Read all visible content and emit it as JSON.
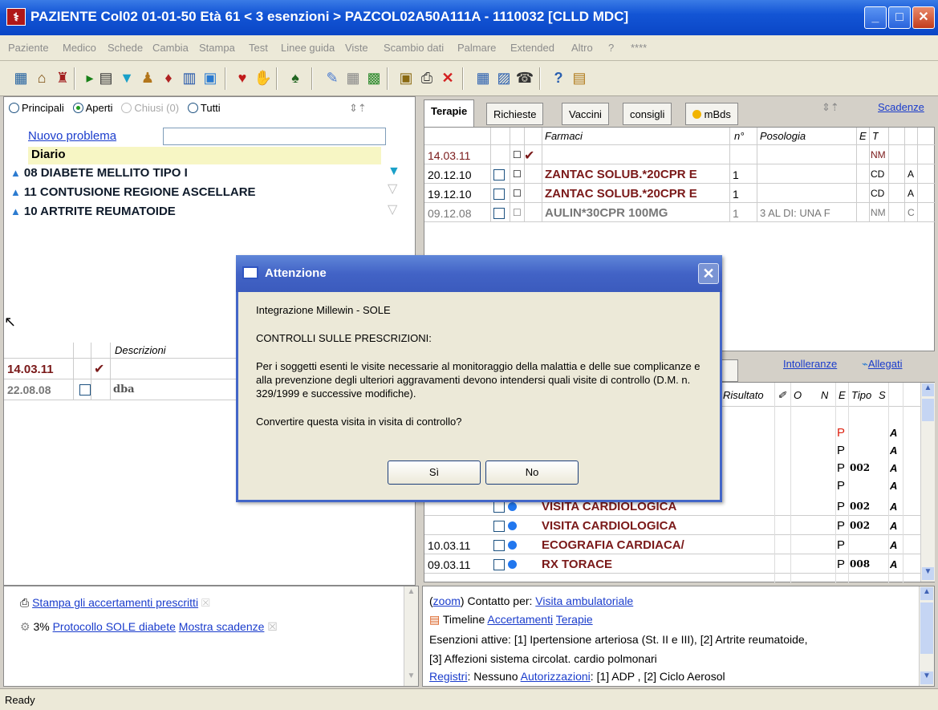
{
  "window": {
    "title": "PAZIENTE Col02  01-01-50  Età 61  < 3 esenzioni >  PAZCOL02A50A111A - 1110032  [CLLD MDC]",
    "icon": "app-icon",
    "min": "_",
    "max": "□",
    "close": "✕"
  },
  "menu": [
    "Paziente",
    "Medico",
    "Schede",
    "Cambia",
    "Stampa",
    "Test",
    "Linee guida",
    "Viste",
    "Scambio dati",
    "Palmare",
    "Extended",
    "Altro",
    "?",
    "****"
  ],
  "left": {
    "filters": {
      "principali": "Principali",
      "aperti": "Aperti",
      "chiusi": "Chiusi (0)",
      "tutti": "Tutti"
    },
    "nuovo_problema": "Nuovo problema",
    "diario": "Diario",
    "problems": [
      "08 DIABETE MELLITO TIPO I",
      "11 CONTUSIONE REGIONE ASCELLARE",
      "10 ARTRITE REUMATOIDE"
    ],
    "diary_header": "Descrizioni",
    "diary_rows": [
      {
        "date": "14.03.11",
        "check": "✔",
        "desc": ""
      },
      {
        "date": "22.08.08",
        "check": "",
        "desc": "dba"
      }
    ]
  },
  "tabs": {
    "terapie": "Terapie",
    "richieste": "Richieste",
    "vaccini": "Vaccini",
    "consigli": "consigli",
    "mbds": "mBds",
    "scadenze": "Scadenze"
  },
  "therapy": {
    "headers": {
      "farmaci": "Farmaci",
      "n": "n°",
      "posologia": "Posologia",
      "e": "E",
      "t": "T"
    },
    "rows": [
      {
        "date": "14.03.11",
        "drug": "",
        "n": "",
        "pos": "",
        "t": "NM",
        "x": ""
      },
      {
        "date": "20.12.10",
        "drug": "ZANTAC SOLUB.*20CPR E",
        "n": "1",
        "pos": "",
        "t": "CD",
        "x": "A"
      },
      {
        "date": "19.12.10",
        "drug": "ZANTAC SOLUB.*20CPR E",
        "n": "1",
        "pos": "",
        "t": "CD",
        "x": "A"
      },
      {
        "date": "09.12.08",
        "drug": "AULIN*30CPR 100MG",
        "n": "1",
        "pos": "3 AL DI: UNA F",
        "t": "NM",
        "x": "C"
      }
    ]
  },
  "lower": {
    "intolleranze": "Intolleranze",
    "allegati": "Allegati",
    "headers": {
      "risultato": "Risultato",
      "o": "O",
      "n": "N",
      "e": "E",
      "tipo": "Tipo",
      "s": "S"
    },
    "rows": [
      {
        "date": "",
        "name": "",
        "e": "P",
        "tipo": "",
        "s": "A"
      },
      {
        "date": "",
        "name": "",
        "e": "P",
        "tipo": "",
        "s": "A"
      },
      {
        "date": "",
        "name": "",
        "e": "P",
        "tipo": "002",
        "s": "A"
      },
      {
        "date": "",
        "name": "",
        "e": "P",
        "tipo": "",
        "s": "A"
      },
      {
        "date": "",
        "name": "VISITA CARDIOLOGICA",
        "e": "P",
        "tipo": "002",
        "s": "A"
      },
      {
        "date": "",
        "name": "VISITA CARDIOLOGICA",
        "e": "P",
        "tipo": "002",
        "s": "A"
      },
      {
        "date": "10.03.11",
        "name": "ECOGRAFIA CARDIACA/",
        "e": "P",
        "tipo": "",
        "s": "A"
      },
      {
        "date": "09.03.11",
        "name": "RX TORACE",
        "e": "P",
        "tipo": "008",
        "s": "A"
      }
    ]
  },
  "bottom_left": {
    "stampa": "Stampa gli accertamenti prescritti",
    "protocollo_pct": "3%",
    "protocollo": "Protocollo SOLE diabete",
    "mostra": "Mostra scadenze"
  },
  "bottom_right": {
    "zoom": "zoom",
    "contatto_label": "Contatto per:",
    "contatto": "Visita ambulatoriale",
    "timeline": "Timeline",
    "accertamenti": "Accertamenti",
    "terapie": "Terapie",
    "esenzioni": "Esenzioni attive: [1] Ipertensione arteriosa (St. II e III), [2] Artrite reumatoide,",
    "esenzioni2": "[3] Affezioni sistema circolat. cardio polmonari",
    "registri": "Registri",
    "registri_val": ": Nessuno",
    "autorizzazioni": "Autorizzazioni",
    "autorizzazioni_val": ": [1] ADP , [2] Ciclo Aerosol"
  },
  "status": "Ready",
  "dialog": {
    "title": "Attenzione",
    "line1": "Integrazione Millewin - SOLE",
    "line2": "CONTROLLI SULLE PRESCRIZIONI:",
    "line3": "Per i soggetti esenti le visite necessarie al monitoraggio della malattia e delle sue complicanze e alla prevenzione degli ulteriori aggravamenti devono intendersi quali visite di controllo (D.M. n. 329/1999 e successive modifiche).",
    "line4": "Convertire questa visita in visita di controllo?",
    "yes": "Sì",
    "no": "No"
  }
}
